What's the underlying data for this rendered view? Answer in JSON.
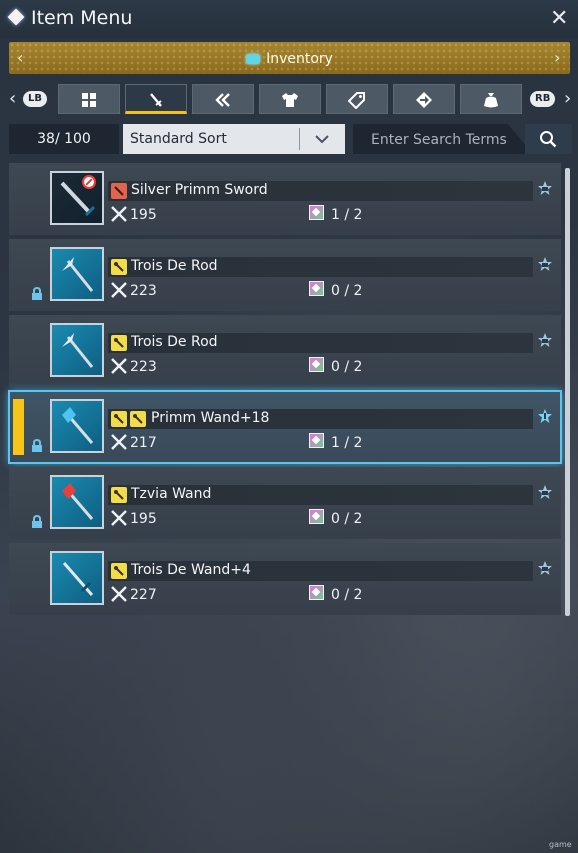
{
  "window": {
    "title": "Item Menu"
  },
  "inventory_bar": {
    "label": "Inventory"
  },
  "category_row": {
    "left_bumper": "LB",
    "right_bumper": "RB",
    "tabs": [
      {
        "icon": "all-items-grid-icon"
      },
      {
        "icon": "sword-weapon-icon",
        "active": true
      },
      {
        "icon": "double-chevron-weapon-icon"
      },
      {
        "icon": "shirt-armor-icon"
      },
      {
        "icon": "tag-icon"
      },
      {
        "icon": "arrow-diamond-icon"
      },
      {
        "icon": "bag-icon"
      }
    ]
  },
  "toolbar": {
    "count": "38/ 100",
    "sort_label": "Standard Sort",
    "search_placeholder": "Enter Search Terms"
  },
  "items": [
    {
      "name": "Silver Primm Sword",
      "attack": "195",
      "augments": "1 / 2",
      "locked": false,
      "selected": false,
      "restricted": true,
      "types": [
        "red"
      ],
      "thumb": "dark"
    },
    {
      "name": "Trois De Rod",
      "attack": "223",
      "augments": "0 / 2",
      "locked": true,
      "selected": false,
      "restricted": false,
      "types": [
        "yellow"
      ],
      "thumb": "blue"
    },
    {
      "name": "Trois De Rod",
      "attack": "223",
      "augments": "0 / 2",
      "locked": false,
      "selected": false,
      "restricted": false,
      "types": [
        "yellow"
      ],
      "thumb": "blue"
    },
    {
      "name": "Primm Wand+18",
      "attack": "217",
      "augments": "1 / 2",
      "locked": true,
      "selected": true,
      "restricted": false,
      "types": [
        "yellow",
        "yellow"
      ],
      "thumb": "blue"
    },
    {
      "name": "Tzvia Wand",
      "attack": "195",
      "augments": "0 / 2",
      "locked": true,
      "selected": false,
      "restricted": false,
      "types": [
        "yellow"
      ],
      "thumb": "blue-red"
    },
    {
      "name": "Trois De Wand+4",
      "attack": "227",
      "augments": "0 / 2",
      "locked": false,
      "selected": false,
      "restricted": false,
      "types": [
        "yellow"
      ],
      "thumb": "blue"
    }
  ],
  "footer": {
    "tag": "game"
  },
  "colors": {
    "accent_gold": "#f5c51a",
    "selection_blue": "#58c6ef",
    "inventory_bar": "#a68630"
  }
}
